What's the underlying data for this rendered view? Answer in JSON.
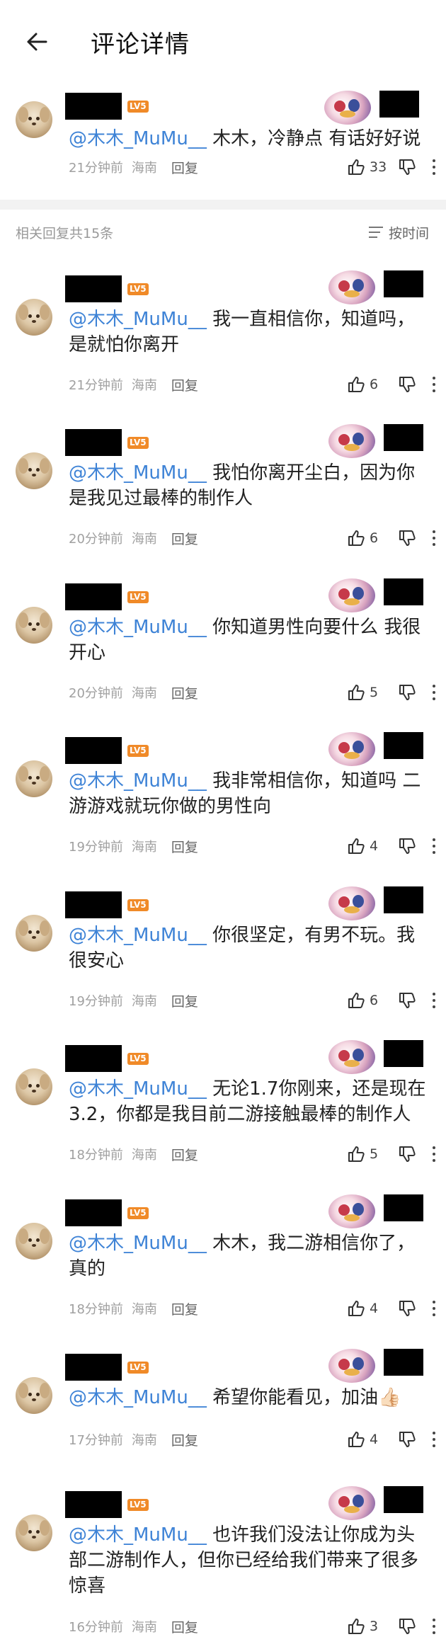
{
  "header": {
    "title": "评论详情"
  },
  "main_comment": {
    "level": "LV5",
    "mention": "@木木_MuMu__",
    "text": " 木木，冷静点 有话好好说",
    "time": "21分钟前",
    "location": "海南",
    "reply_label": "回复",
    "likes": "33"
  },
  "replies_header": {
    "count_text": "相关回复共15条",
    "sort_label": "按时间"
  },
  "replies": [
    {
      "level": "LV5",
      "mention": "@木木_MuMu__",
      "text": " 我一直相信你，知道吗，是就怕你离开",
      "time": "21分钟前",
      "location": "海南",
      "reply_label": "回复",
      "likes": "6"
    },
    {
      "level": "LV5",
      "mention": "@木木_MuMu__",
      "text": " 我怕你离开尘白，因为你是我见过最棒的制作人",
      "time": "20分钟前",
      "location": "海南",
      "reply_label": "回复",
      "likes": "6"
    },
    {
      "level": "LV5",
      "mention": "@木木_MuMu__",
      "text": " 你知道男性向要什么 我很开心",
      "time": "20分钟前",
      "location": "海南",
      "reply_label": "回复",
      "likes": "5"
    },
    {
      "level": "LV5",
      "mention": "@木木_MuMu__",
      "text": " 我非常相信你，知道吗 二游游戏就玩你做的男性向",
      "time": "19分钟前",
      "location": "海南",
      "reply_label": "回复",
      "likes": "4"
    },
    {
      "level": "LV5",
      "mention": "@木木_MuMu__",
      "text": " 你很坚定，有男不玩。我很安心",
      "time": "19分钟前",
      "location": "海南",
      "reply_label": "回复",
      "likes": "6"
    },
    {
      "level": "LV5",
      "mention": "@木木_MuMu__",
      "text": " 无论1.7你刚来，还是现在3.2，你都是我目前二游接触最棒的制作人",
      "time": "18分钟前",
      "location": "海南",
      "reply_label": "回复",
      "likes": "5"
    },
    {
      "level": "LV5",
      "mention": "@木木_MuMu__",
      "text": " 木木，我二游相信你了，真的",
      "time": "18分钟前",
      "location": "海南",
      "reply_label": "回复",
      "likes": "4"
    },
    {
      "level": "LV5",
      "mention": "@木木_MuMu__",
      "text": " 希望你能看见，加油👍🏻",
      "time": "17分钟前",
      "location": "海南",
      "reply_label": "回复",
      "likes": "4"
    },
    {
      "level": "LV5",
      "mention": "@木木_MuMu__",
      "text": " 也许我们没法让你成为头部二游制作人，但你已经给我们带来了很多惊喜",
      "time": "16分钟前",
      "location": "海南",
      "reply_label": "回复",
      "likes": "3"
    }
  ]
}
